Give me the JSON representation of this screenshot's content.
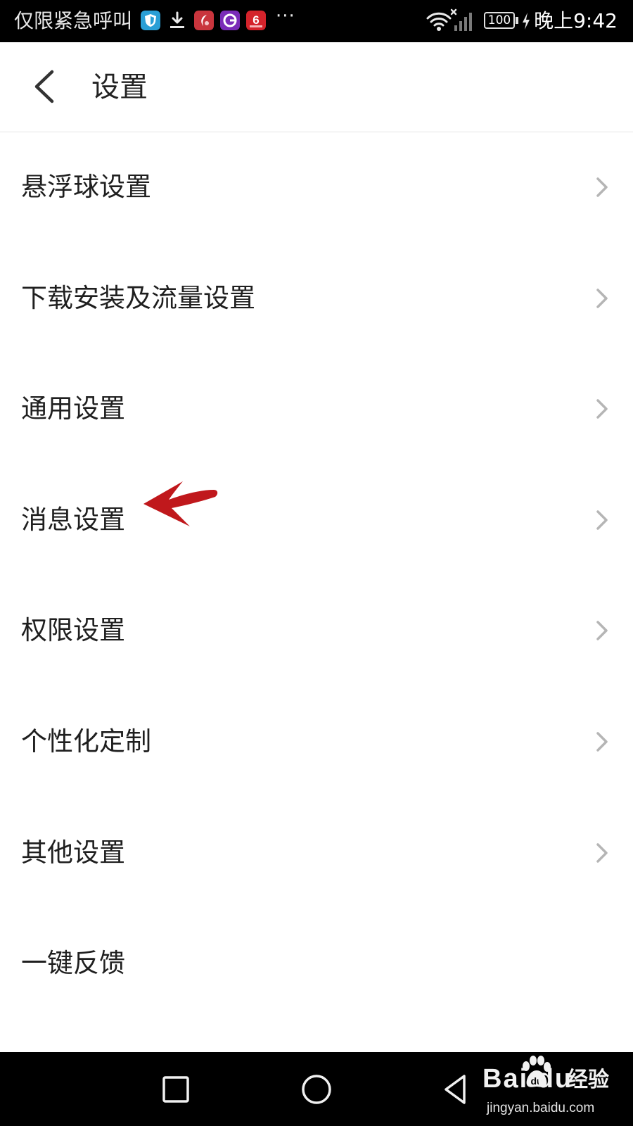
{
  "status_bar": {
    "carrier_text": "仅限紧急呼叫",
    "more_indicator": "···",
    "battery_level": "100",
    "time": "晚上9:42",
    "icons": [
      "shield-app-icon",
      "download-icon",
      "red-app-icon",
      "purple-app-icon",
      "number-six-app-icon",
      "wifi-icon",
      "signal-icon",
      "battery-icon",
      "charging-icon"
    ]
  },
  "header": {
    "title": "设置",
    "back_icon": "chevron-left-icon"
  },
  "settings": {
    "items": [
      {
        "label": "悬浮球设置",
        "has_chevron": true
      },
      {
        "label": "下载安装及流量设置",
        "has_chevron": true
      },
      {
        "label": "通用设置",
        "has_chevron": true
      },
      {
        "label": "消息设置",
        "has_chevron": true
      },
      {
        "label": "权限设置",
        "has_chevron": true
      },
      {
        "label": "个性化定制",
        "has_chevron": true
      },
      {
        "label": "其他设置",
        "has_chevron": true
      },
      {
        "label": "一键反馈",
        "has_chevron": false
      }
    ]
  },
  "annotation": {
    "target": "消息设置",
    "color": "#c0181c"
  },
  "navigation": {
    "buttons": [
      "recent-apps-square-icon",
      "home-circle-icon",
      "back-triangle-icon"
    ]
  },
  "watermark": {
    "logo": "Bai du",
    "product": "经验",
    "url": "jingyan.baidu.com"
  },
  "colors": {
    "status_bar_bg": "#000000",
    "nav_bar_bg": "#000000",
    "page_bg": "#ffffff",
    "text": "#1f1f1f",
    "chevron": "#b5b5b5",
    "divider": "#e6e6e6"
  }
}
